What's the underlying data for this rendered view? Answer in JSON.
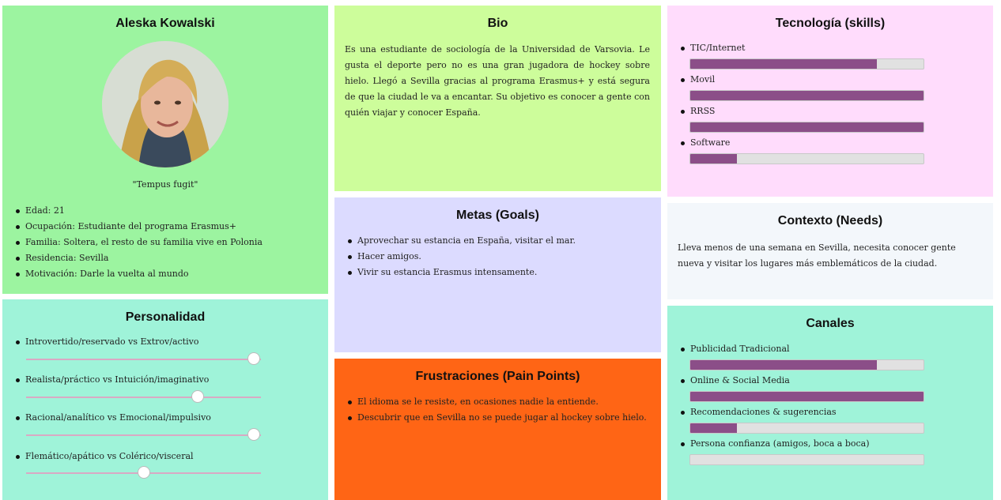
{
  "profile": {
    "name": "Aleska Kowalski",
    "quote": "\"Tempus fugit\"",
    "details": [
      "Edad: 21",
      "Ocupación: Estudiante del programa Erasmus+",
      "Familia: Soltera, el resto de su familia vive en Polonia",
      "Residencia: Sevilla",
      "Motivación: Darle la vuelta al mundo"
    ]
  },
  "personality": {
    "title": "Personalidad",
    "traits": [
      {
        "label": "Introvertido/reservado vs Extrov/activo",
        "value": 0.97
      },
      {
        "label": "Realista/práctico vs Intuición/imaginativo",
        "value": 0.73
      },
      {
        "label": "Racional/analítico vs Emocional/impulsivo",
        "value": 0.97
      },
      {
        "label": "Flemático/apático vs Colérico/visceral",
        "value": 0.5
      }
    ]
  },
  "bio": {
    "title": "Bio",
    "text": "Es una estudiante de sociología de la Universidad de Varsovia. Le gusta el deporte pero no es una gran jugadora de hockey sobre hielo. Llegó a Sevilla gracias al programa Erasmus+ y está segura de que la ciudad le va a encantar. Su objetivo es conocer a gente con quién viajar y conocer España."
  },
  "goals": {
    "title": "Metas (Goals)",
    "items": [
      "Aprovechar su estancia en España, visitar el mar.",
      "Hacer amigos.",
      "Vivir su estancia Erasmus intensamente."
    ]
  },
  "frustrations": {
    "title": "Frustraciones (Pain Points)",
    "items": [
      "El idioma se le resiste, en ocasiones nadie la entiende.",
      "Descubrir que en Sevilla no se puede jugar al hockey sobre hielo."
    ]
  },
  "technology": {
    "title": "Tecnología (skills)",
    "skills": [
      {
        "label": "TIC/Internet",
        "value": 0.8
      },
      {
        "label": "Movil",
        "value": 1.0
      },
      {
        "label": "RRSS",
        "value": 1.0
      },
      {
        "label": "Software",
        "value": 0.2
      }
    ]
  },
  "context": {
    "title": "Contexto (Needs)",
    "text": "Lleva menos de una semana en Sevilla, necesita conocer gente nueva y visitar los lugares más emblemáticos de la ciudad."
  },
  "channels": {
    "title": "Canales",
    "items": [
      {
        "label": "Publicidad Tradicional",
        "value": 0.8
      },
      {
        "label": "Online & Social Media",
        "value": 1.0
      },
      {
        "label": "Recomendaciones & sugerencias",
        "value": 0.2
      },
      {
        "label": "Persona confianza (amigos, boca a boca)",
        "value": 0.0
      }
    ]
  },
  "colors": {
    "bar_fill": "#8b4e88",
    "bar_track": "#e1e1e1",
    "slider_track": "#d9a9c4"
  }
}
